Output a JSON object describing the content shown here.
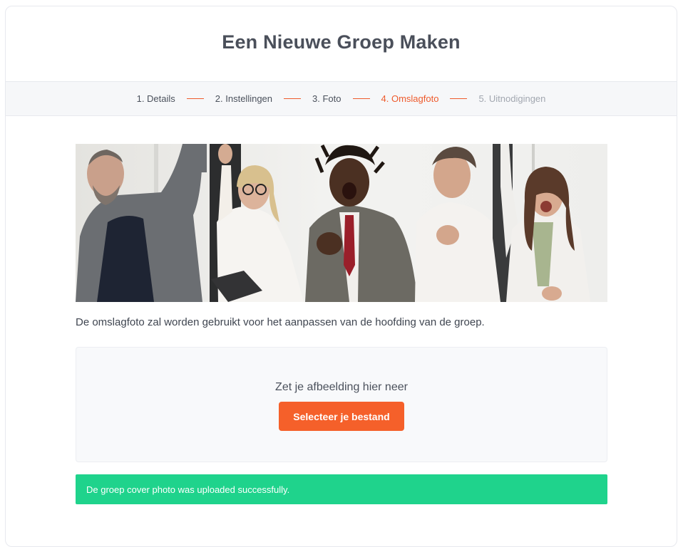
{
  "header": {
    "title": "Een Nieuwe Groep Maken"
  },
  "steps": [
    {
      "label": "1. Details",
      "state": "done"
    },
    {
      "label": "2. Instellingen",
      "state": "done"
    },
    {
      "label": "3. Foto",
      "state": "done"
    },
    {
      "label": "4. Omslagfoto",
      "state": "active"
    },
    {
      "label": "5. Uitnodigingen",
      "state": "pending"
    }
  ],
  "cover": {
    "image": "photo of five cheering business people",
    "description": "De omslagfoto zal worden gebruikt voor het aanpassen van de hoofding van de groep."
  },
  "dropzone": {
    "text": "Zet je afbeelding hier neer",
    "button_label": "Selecteer je bestand"
  },
  "alert": {
    "text": "De groep cover photo was uploaded successfully."
  },
  "colors": {
    "accent": "#f5602a",
    "active_step": "#ee5a2c",
    "success": "#1fd38c"
  }
}
